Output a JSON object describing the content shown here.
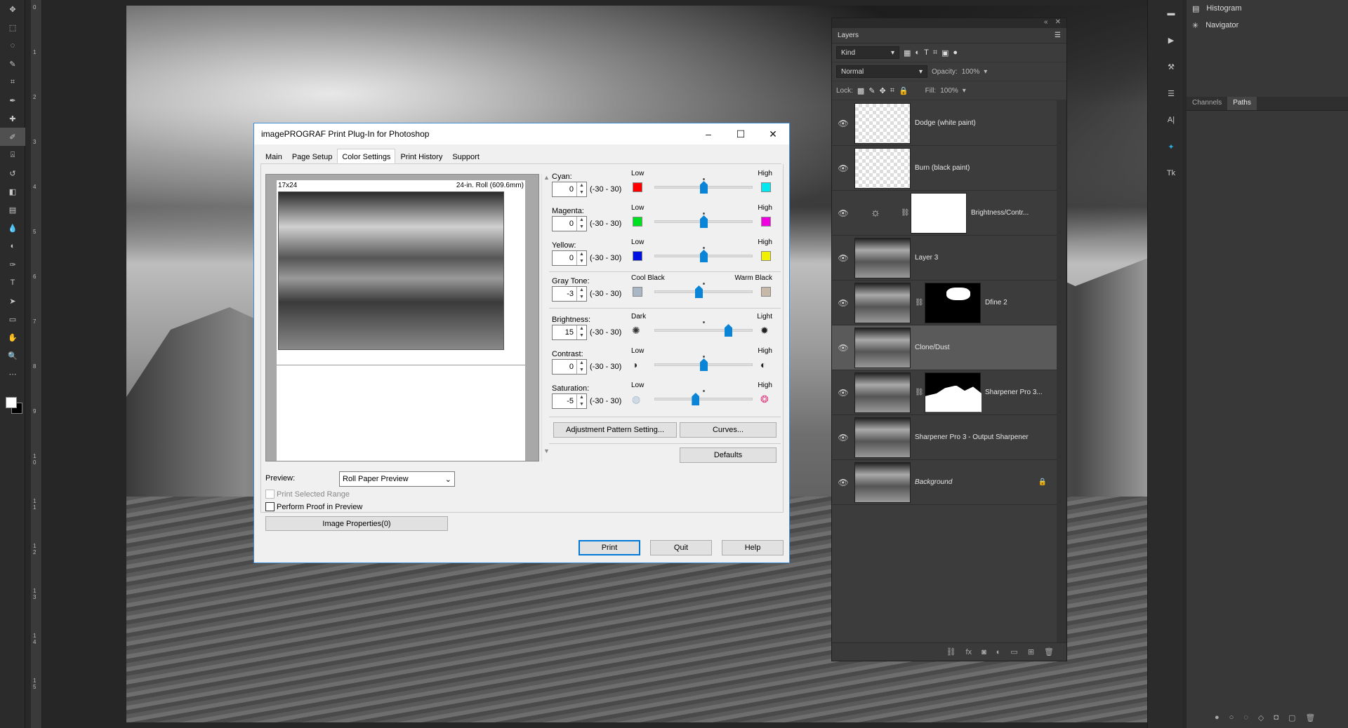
{
  "app": {
    "left_ruler_numbers": [
      "0",
      "1",
      "2",
      "3",
      "4",
      "5",
      "6",
      "7",
      "8",
      "9",
      "1\n0",
      "1\n1",
      "1\n2",
      "1\n3",
      "1\n4",
      "1\n5"
    ]
  },
  "tools": [
    {
      "name": "move-tool",
      "icon": "move-icon"
    },
    {
      "name": "marquee-tool",
      "icon": "marquee-icon"
    },
    {
      "name": "lasso-tool",
      "icon": "lasso-icon"
    },
    {
      "name": "quick-select-tool",
      "icon": "quick-select-icon"
    },
    {
      "name": "crop-tool",
      "icon": "crop-icon"
    },
    {
      "name": "eyedropper-tool",
      "icon": "eyedropper-icon"
    },
    {
      "name": "healing-tool",
      "icon": "bandage-icon"
    },
    {
      "name": "brush-tool",
      "icon": "brush-icon"
    },
    {
      "name": "stamp-tool",
      "icon": "stamp-icon"
    },
    {
      "name": "history-brush-tool",
      "icon": "history-brush-icon"
    },
    {
      "name": "eraser-tool",
      "icon": "eraser-icon"
    },
    {
      "name": "gradient-tool",
      "icon": "gradient-icon"
    },
    {
      "name": "blur-tool",
      "icon": "drop-icon"
    },
    {
      "name": "dodge-tool",
      "icon": "dodge-icon"
    },
    {
      "name": "pen-tool",
      "icon": "pen-icon"
    },
    {
      "name": "type-tool",
      "icon": "type-icon"
    },
    {
      "name": "path-select-tool",
      "icon": "arrow-icon"
    },
    {
      "name": "shape-tool",
      "icon": "rectangle-icon"
    },
    {
      "name": "hand-tool",
      "icon": "hand-icon"
    },
    {
      "name": "zoom-tool",
      "icon": "zoom-icon"
    },
    {
      "name": "more-tools",
      "icon": "ellipsis-icon"
    }
  ],
  "right_panel": {
    "histogram": "Histogram",
    "navigator": "Navigator",
    "tabs": [
      "Channels",
      "Paths"
    ]
  },
  "layers": {
    "title": "Layers",
    "filter_kind": "Kind",
    "blend_mode": "Normal",
    "opacity_label": "Opacity:",
    "opacity_value": "100%",
    "lock_label": "Lock:",
    "fill_label": "Fill:",
    "fill_value": "100%",
    "items": [
      {
        "name": "Dodge (white paint)",
        "thumb": "check",
        "mask": ""
      },
      {
        "name": "Burn (black paint)",
        "thumb": "check",
        "mask": ""
      },
      {
        "name": "Brightness/Contr...",
        "thumb": "adjust",
        "mask": "white"
      },
      {
        "name": "Layer 3",
        "thumb": "photo",
        "mask": ""
      },
      {
        "name": "Dfine 2",
        "thumb": "photo",
        "mask": "mask1"
      },
      {
        "name": "Clone/Dust",
        "thumb": "photo",
        "mask": ""
      },
      {
        "name": "Sharpener Pro 3...",
        "thumb": "photo",
        "mask": "mask2"
      },
      {
        "name": "Sharpener Pro 3 - Output Sharpener",
        "thumb": "photo",
        "mask": ""
      },
      {
        "name": "Background",
        "thumb": "photo",
        "mask": ""
      }
    ]
  },
  "dialog": {
    "title": "imagePROGRAF Print Plug-In for Photoshop",
    "tabs": [
      "Main",
      "Page Setup",
      "Color Settings",
      "Print History",
      "Support"
    ],
    "active_tab": "Color Settings",
    "preview": {
      "size": "17x24",
      "roll": "24-in. Roll (609.6mm)",
      "preview_label": "Preview:",
      "preview_value": "Roll Paper Preview",
      "print_selected_range": "Print Selected Range",
      "perform_proof": "Perform Proof in Preview",
      "image_properties": "Image Properties(0)"
    },
    "adjustments": [
      {
        "label": "Cyan:",
        "value": "0",
        "range": "(-30 - 30)",
        "low": "Low",
        "high": "High",
        "low_color": "#ff0000",
        "high_color": "#00e8f0",
        "level": 0
      },
      {
        "label": "Magenta:",
        "value": "0",
        "range": "(-30 - 30)",
        "low": "Low",
        "high": "High",
        "low_color": "#00e020",
        "high_color": "#f000e0",
        "level": 0
      },
      {
        "label": "Yellow:",
        "value": "0",
        "range": "(-30 - 30)",
        "low": "Low",
        "high": "High",
        "low_color": "#0010e0",
        "high_color": "#f0f000",
        "level": 0
      },
      {
        "label": "Gray Tone:",
        "value": "-3",
        "range": "(-30 - 30)",
        "low": "Cool Black",
        "high": "Warm Black",
        "low_color": "#a9b6c6",
        "high_color": "#c8b8a8",
        "level": -3
      },
      {
        "label": "Brightness:",
        "value": "15",
        "range": "(-30 - 30)",
        "low": "Dark",
        "high": "Light",
        "low_color": "",
        "high_color": "",
        "level": 15
      },
      {
        "label": "Contrast:",
        "value": "0",
        "range": "(-30 - 30)",
        "low": "Low",
        "high": "High",
        "low_color": "",
        "high_color": "",
        "level": 0
      },
      {
        "label": "Saturation:",
        "value": "-5",
        "range": "(-30 - 30)",
        "low": "Low",
        "high": "High",
        "low_color": "",
        "high_color": "",
        "level": -5
      }
    ],
    "buttons": {
      "adjustment_pattern": "Adjustment Pattern Setting...",
      "curves": "Curves...",
      "defaults": "Defaults",
      "print": "Print",
      "quit": "Quit",
      "help": "Help"
    }
  }
}
